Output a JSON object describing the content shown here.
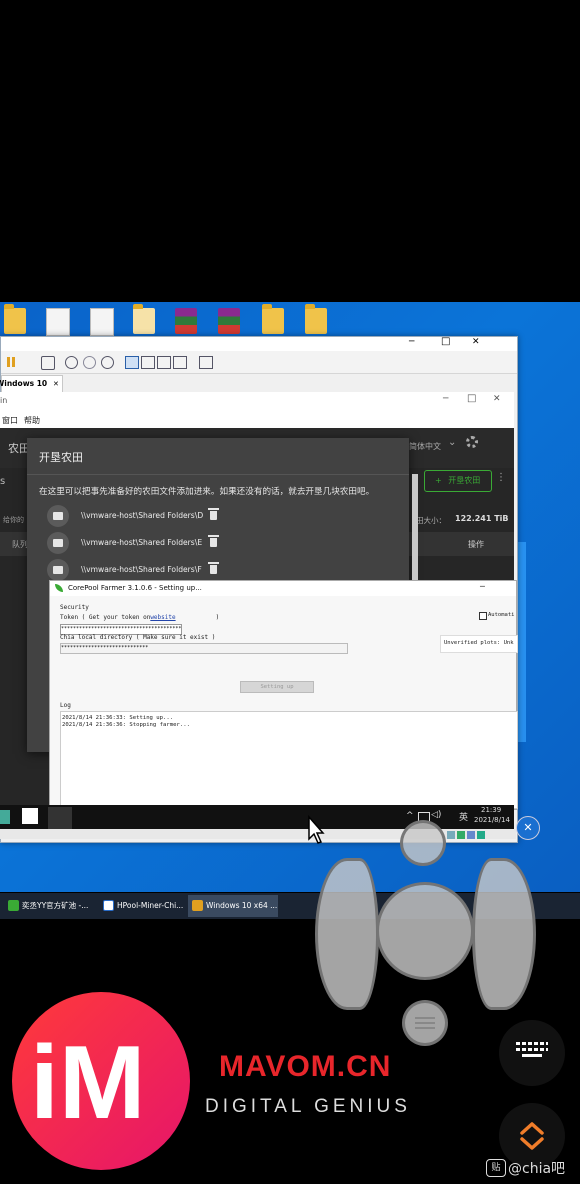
{
  "vm_window": {
    "tab_label": "Windows 10 x64",
    "tab_close": "✕",
    "host_controls": {
      "min": "─",
      "max": "□",
      "close": "✕"
    }
  },
  "guest_window": {
    "title_fragment": "in",
    "menu": {
      "window": "窗口",
      "help": "帮助"
    },
    "controls": {
      "min": "─",
      "max": "□",
      "close": "✕"
    }
  },
  "chia_app": {
    "header_title": "农田",
    "language": "简体中文",
    "chevron": "⌄",
    "left_fragment_1": "s",
    "left_fragment_2": "给你的",
    "left_fragment_3": "队列",
    "add_farm_button": "开垦农田",
    "add_plus": "+",
    "farm_size_label": "田大小：",
    "farm_size_value": "122.241 TiB",
    "actions_header": "操作",
    "more": "⋮"
  },
  "add_dialog": {
    "title": "开垦农田",
    "description": "在这里可以把事先准备好的农田文件添加进来。如果还没有的话，就去开垦几块农田吧。",
    "paths": [
      "\\\\vmware-host\\Shared Folders\\D",
      "\\\\vmware-host\\Shared Folders\\E",
      "\\\\vmware-host\\Shared Folders\\F"
    ]
  },
  "corepool": {
    "title": "CorePool Farmer 3.1.0.6 - Setting up...",
    "min": "─",
    "section_security": "Security",
    "token_label": "Token ( Get your token on",
    "token_link": "website",
    "token_close": ")",
    "token_value": "****************************************",
    "dir_label": "Chia local directory ( Make sure it exist )",
    "dir_value": "*****************************",
    "automation_label": "Automati",
    "unverified_label": "Unverified plots: Unk",
    "setting_up_button": "Setting up",
    "log_label": "Log",
    "log_lines": [
      "2021/8/14 21:36:33: Setting up...",
      "2021/8/14 21:36:36: Stopping farmer..."
    ]
  },
  "guest_taskbar": {
    "time": "21:39",
    "date": "2021/8/14",
    "ime": "英"
  },
  "host_taskbar": {
    "items": [
      "奕丞YY官方矿池 -...",
      "HPool-Miner-Chi...",
      "Windows 10 x64 ..."
    ]
  },
  "overlay": {
    "close_icon": "✕"
  },
  "branding": {
    "logo_letters": "iM",
    "site": "MAVOM.CN",
    "tagline": "DIGITAL GENIUS",
    "watermark": "@chia吧",
    "watermark_badge": "贴"
  },
  "colors": {
    "desktop_blue": "#0b6fd3",
    "chia_green": "#3aaa35",
    "logo_red": "#ff3a3a",
    "site_red": "#e8262b"
  }
}
